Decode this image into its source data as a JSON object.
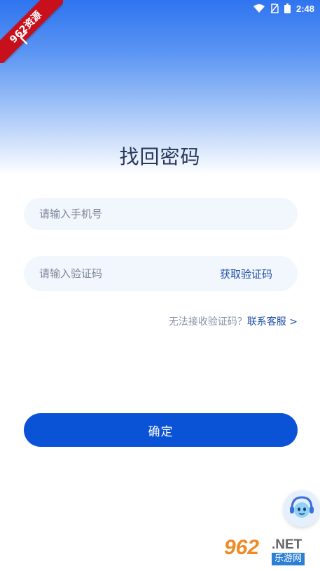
{
  "status_bar": {
    "time": "2:48",
    "icons": [
      "wifi-icon",
      "no-sim-icon",
      "battery-icon"
    ]
  },
  "watermark": {
    "ribbon_text": "962资源",
    "logo_number": "962",
    "logo_net": ".NET",
    "logo_site": "乐游网"
  },
  "header": {
    "back_icon": "chevron-left-icon",
    "title": "找回密码"
  },
  "form": {
    "phone_placeholder": "请输入手机号",
    "code_placeholder": "请输入验证码",
    "get_code_label": "获取验证码"
  },
  "help": {
    "question": "无法接收验证码？",
    "contact_label": "联系客服 >"
  },
  "actions": {
    "confirm_label": "确定"
  },
  "floating": {
    "service_icon": "customer-service-icon"
  },
  "colors": {
    "primary": "#0a52d6",
    "link": "#1f4fa8",
    "title": "#27385a",
    "field_bg": "#f2f6fd",
    "gradient_top": "#2f74f0"
  }
}
